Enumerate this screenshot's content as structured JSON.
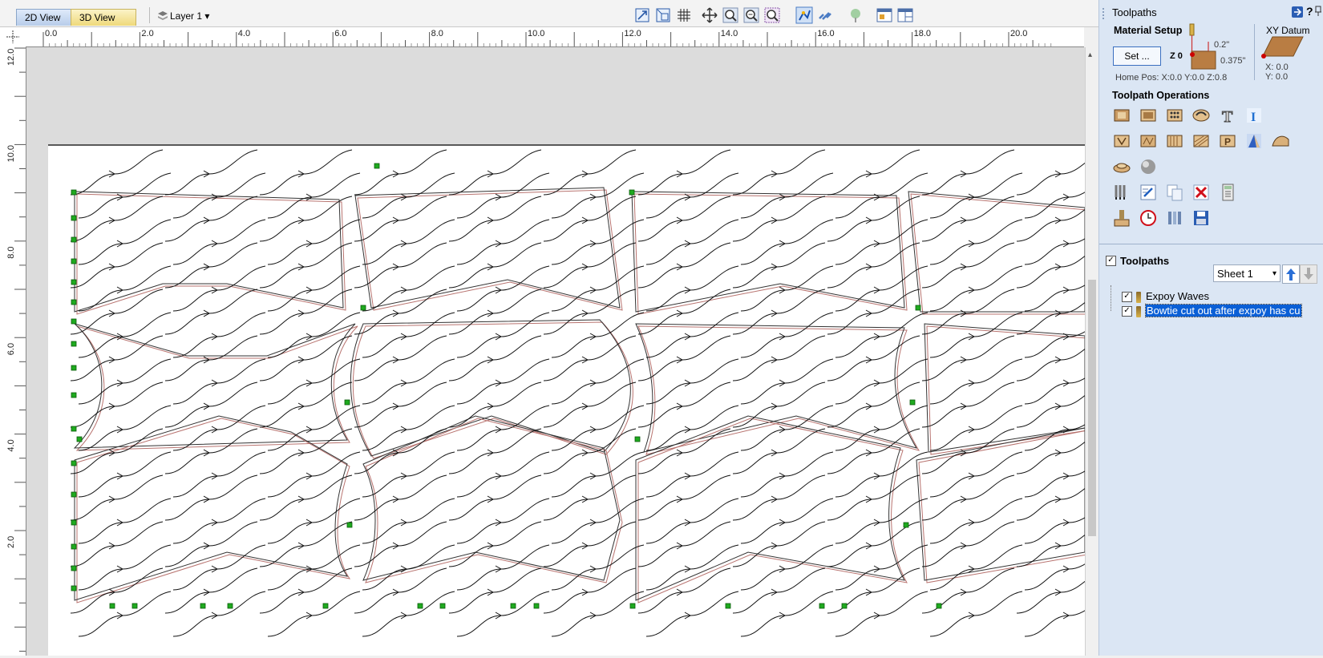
{
  "view_tabs": {
    "tab_2d": "2D View",
    "tab_3d": "3D View"
  },
  "layer": {
    "label": "Layer 1",
    "caret": "▾"
  },
  "toolbar_icons": [
    "zoom-selection-icon",
    "zoom-box-icon",
    "grid-icon",
    "pan-icon",
    "zoom-in-icon",
    "zoom-out-icon",
    "zoom-extents-icon",
    "snap-icon",
    "link-icon",
    "render-icon",
    "layout-icon",
    "split-view-icon"
  ],
  "ruler": {
    "h_labels": [
      "0.0",
      "2.0",
      "4.0",
      "6.0",
      "8.0",
      "10.0",
      "12.0",
      "14.0",
      "16.0",
      "18.0",
      "20.0"
    ],
    "v_labels": [
      "12.0",
      "10.0",
      "8.0",
      "6.0",
      "4.0",
      "2.0"
    ]
  },
  "panel": {
    "title": "Toolpaths",
    "header_icons": [
      "pin-icon",
      "help-icon",
      "autohide-icon"
    ],
    "help_label": "?",
    "material_setup": {
      "title": "Material Setup",
      "set_button": "Set ...",
      "z_label": "Z 0",
      "top_offset": "0.2\"",
      "thickness": "0.375\"",
      "home_pos": "Home Pos:   X:0.0 Y:0.0 Z:0.8"
    },
    "xy_datum": {
      "title": "XY Datum",
      "x": "X: 0.0",
      "y": "Y: 0.0"
    },
    "toolpath_operations": {
      "title": "Toolpath Operations",
      "row1": [
        "profile-icon",
        "pocket-icon",
        "drilling-icon",
        "quick-engrave-icon",
        "texture-icon",
        "inlay-icon"
      ],
      "row2": [
        "vcarve-icon",
        "prism-icon",
        "fluting-icon",
        "moulding-icon",
        "chamfer-icon",
        "3d-finish-icon",
        "3d-rough-icon"
      ],
      "row3": [
        "3d-profile-icon",
        "sphere-icon"
      ],
      "row4": [
        "toolpath-tiling-icon",
        "edit-toolpath-icon",
        "copy-toolpath-icon",
        "delete-toolpath-icon",
        "calculator-icon"
      ],
      "row5": [
        "preview-toolpath-icon",
        "time-estimate-icon",
        "merge-toolpath-icon",
        "save-toolpath-icon"
      ]
    },
    "toolpaths_list": {
      "header": "Toolpaths",
      "sheet": "Sheet 1",
      "items": [
        {
          "label": "Expoy Waves",
          "checked": true,
          "selected": false
        },
        {
          "label": "Bowtie cut out after expoy has cu",
          "checked": true,
          "selected": true
        }
      ]
    }
  },
  "colors": {
    "accent": "#0a5fd6",
    "node_green": "#1faa1f",
    "toolpath_red": "#b8736f",
    "sheet_border": "#000000"
  }
}
